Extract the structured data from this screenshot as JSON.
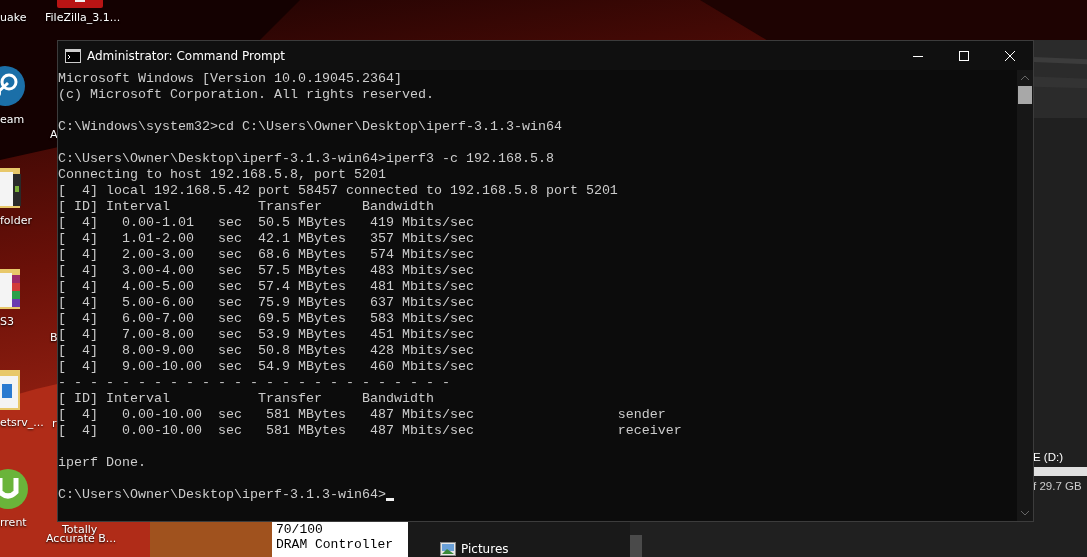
{
  "desktop": {
    "labels": [
      {
        "text": "uake"
      },
      {
        "text": "FileZilla_3.1..."
      },
      {
        "text": "eam"
      },
      {
        "text": "A"
      },
      {
        "text": "folder"
      },
      {
        "text": "S3"
      },
      {
        "text": "B"
      },
      {
        "text": "etsrv_..."
      },
      {
        "text": "r"
      },
      {
        "text": "rrent"
      },
      {
        "text": "Totally"
      },
      {
        "text": "Accurate B..."
      }
    ]
  },
  "background_window": {
    "lines": [
      "70/100",
      "DRAM Controller"
    ]
  },
  "explorer": {
    "nav_item": "Pictures",
    "drive_label": "E (D:)",
    "drive_size": "f 29.7 GB"
  },
  "window": {
    "title": "Administrator: Command Prompt",
    "blocks": [
      [
        "Microsoft Windows [Version 10.0.19045.2364]",
        "(c) Microsoft Corporation. All rights reserved."
      ],
      [
        "C:\\Windows\\system32>cd C:\\Users\\Owner\\Desktop\\iperf-3.1.3-win64"
      ],
      [
        "C:\\Users\\Owner\\Desktop\\iperf-3.1.3-win64>iperf3 -c 192.168.5.8",
        "Connecting to host 192.168.5.8, port 5201",
        "[  4] local 192.168.5.42 port 58457 connected to 192.168.5.8 port 5201",
        "[ ID] Interval           Transfer     Bandwidth",
        "[  4]   0.00-1.01   sec  50.5 MBytes   419 Mbits/sec",
        "[  4]   1.01-2.00   sec  42.1 MBytes   357 Mbits/sec",
        "[  4]   2.00-3.00   sec  68.6 MBytes   574 Mbits/sec",
        "[  4]   3.00-4.00   sec  57.5 MBytes   483 Mbits/sec",
        "[  4]   4.00-5.00   sec  57.4 MBytes   481 Mbits/sec",
        "[  4]   5.00-6.00   sec  75.9 MBytes   637 Mbits/sec",
        "[  4]   6.00-7.00   sec  69.5 MBytes   583 Mbits/sec",
        "[  4]   7.00-8.00   sec  53.9 MBytes   451 Mbits/sec",
        "[  4]   8.00-9.00   sec  50.8 MBytes   428 Mbits/sec",
        "[  4]   9.00-10.00  sec  54.9 MBytes   460 Mbits/sec",
        "- - - - - - - - - - - - - - - - - - - - - - - - -",
        "[ ID] Interval           Transfer     Bandwidth",
        "[  4]   0.00-10.00  sec   581 MBytes   487 Mbits/sec                  sender",
        "[  4]   0.00-10.00  sec   581 MBytes   487 Mbits/sec                  receiver"
      ],
      [
        "iperf Done."
      ],
      [
        "C:\\Users\\Owner\\Desktop\\iperf-3.1.3-win64>"
      ]
    ],
    "cursor": true
  }
}
